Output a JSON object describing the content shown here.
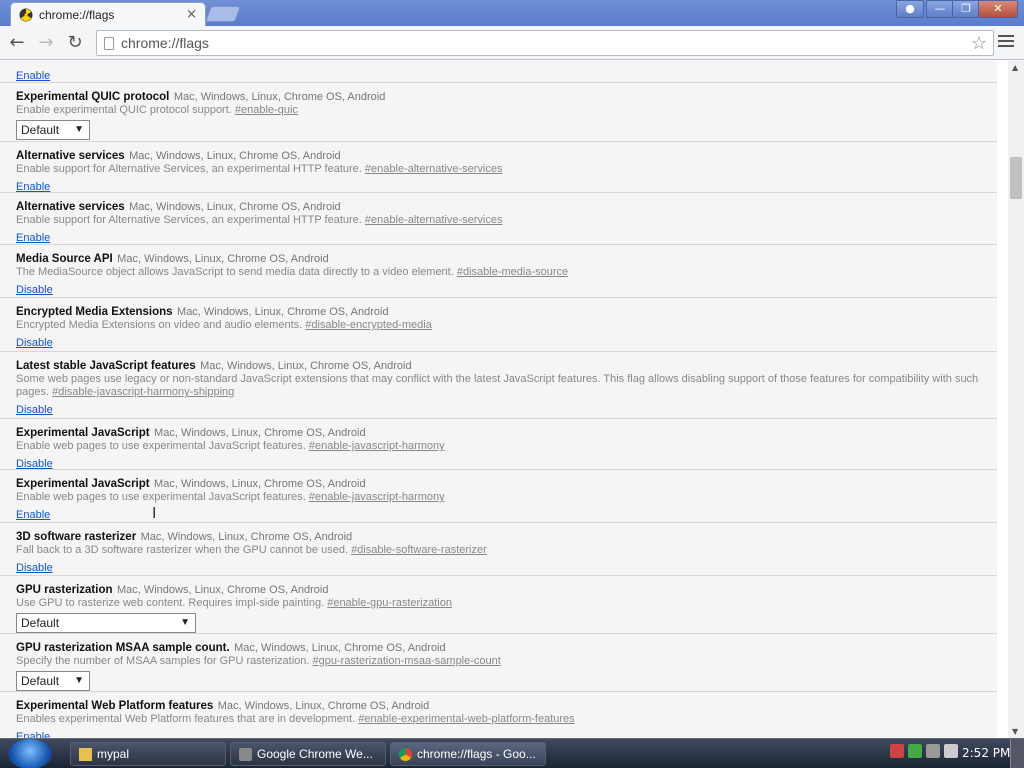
{
  "tab": {
    "title": "chrome://flags",
    "close": "×"
  },
  "window_controls": {
    "user": "●",
    "minimize": "—",
    "restore": "❐",
    "close": "✕"
  },
  "toolbar": {
    "back": "←",
    "forward": "→",
    "reload": "↻",
    "url": "chrome://flags",
    "star": "☆"
  },
  "flags": [
    {
      "name": "",
      "platforms": "",
      "desc": "",
      "anchor": "",
      "action": "Enable",
      "type": "link"
    },
    {
      "name": "Experimental QUIC protocol",
      "platforms": "Mac, Windows, Linux, Chrome OS, Android",
      "desc": "Enable experimental QUIC protocol support. ",
      "anchor": "#enable-quic",
      "action": "Default",
      "type": "select"
    },
    {
      "name": "Alternative services",
      "platforms": "Mac, Windows, Linux, Chrome OS, Android",
      "desc": "Enable support for Alternative Services, an experimental HTTP feature. ",
      "anchor": "#enable-alternative-services",
      "action": "Enable",
      "type": "link"
    },
    {
      "name": "Alternative services",
      "platforms": "Mac, Windows, Linux, Chrome OS, Android",
      "desc": "Enable support for Alternative Services, an experimental HTTP feature. ",
      "anchor": "#enable-alternative-services",
      "action": "Enable",
      "type": "link"
    },
    {
      "name": "Media Source API",
      "platforms": "Mac, Windows, Linux, Chrome OS, Android",
      "desc": "The MediaSource object allows JavaScript to send media data directly to a video element. ",
      "anchor": "#disable-media-source",
      "action": "Disable",
      "type": "link"
    },
    {
      "name": "Encrypted Media Extensions",
      "platforms": "Mac, Windows, Linux, Chrome OS, Android",
      "desc": "Encrypted Media Extensions on video and audio elements. ",
      "anchor": "#disable-encrypted-media",
      "action": "Disable",
      "type": "link"
    },
    {
      "name": "Latest stable JavaScript features",
      "platforms": "Mac, Windows, Linux, Chrome OS, Android",
      "desc": "Some web pages use legacy or non-standard JavaScript extensions that may conflict with the latest JavaScript features. This flag allows disabling support of those features for compatibility with such pages. ",
      "anchor": "#disable-javascript-harmony-shipping",
      "action": "Disable",
      "type": "link"
    },
    {
      "name": "Experimental JavaScript",
      "platforms": "Mac, Windows, Linux, Chrome OS, Android",
      "desc": "Enable web pages to use experimental JavaScript features. ",
      "anchor": "#enable-javascript-harmony",
      "action": "Disable",
      "type": "link"
    },
    {
      "name": "Experimental JavaScript",
      "platforms": "Mac, Windows, Linux, Chrome OS, Android",
      "desc": "Enable web pages to use experimental JavaScript features. ",
      "anchor": "#enable-javascript-harmony",
      "action": "Enable",
      "type": "link"
    },
    {
      "name": "3D software rasterizer",
      "platforms": "Mac, Windows, Linux, Chrome OS, Android",
      "desc": "Fall back to a 3D software rasterizer when the GPU cannot be used. ",
      "anchor": "#disable-software-rasterizer",
      "action": "Disable",
      "type": "link"
    },
    {
      "name": "GPU rasterization",
      "platforms": "Mac, Windows, Linux, Chrome OS, Android",
      "desc": "Use GPU to rasterize web content. Requires impl-side painting. ",
      "anchor": "#enable-gpu-rasterization",
      "action": "Default",
      "type": "select-wide"
    },
    {
      "name": "GPU rasterization MSAA sample count.",
      "platforms": "Mac, Windows, Linux, Chrome OS, Android",
      "desc": "Specify the number of MSAA samples for GPU rasterization. ",
      "anchor": "#gpu-rasterization-msaa-sample-count",
      "action": "Default",
      "type": "select"
    },
    {
      "name": "Experimental Web Platform features",
      "platforms": "Mac, Windows, Linux, Chrome OS, Android",
      "desc": "Enables experimental Web Platform features that are in development. ",
      "anchor": "#enable-experimental-web-platform-features",
      "action": "Enable",
      "type": "link"
    }
  ],
  "taskbar": {
    "items": [
      {
        "label": "mypal",
        "active": false
      },
      {
        "label": "Google Chrome We...",
        "active": false
      },
      {
        "label": "chrome://flags - Goo...",
        "active": true
      }
    ],
    "clock": "2:52 PM"
  },
  "colors": {
    "link": "#1155cc",
    "titlebar": "#5a7ccb",
    "row_bg": "#f5f5f5"
  }
}
